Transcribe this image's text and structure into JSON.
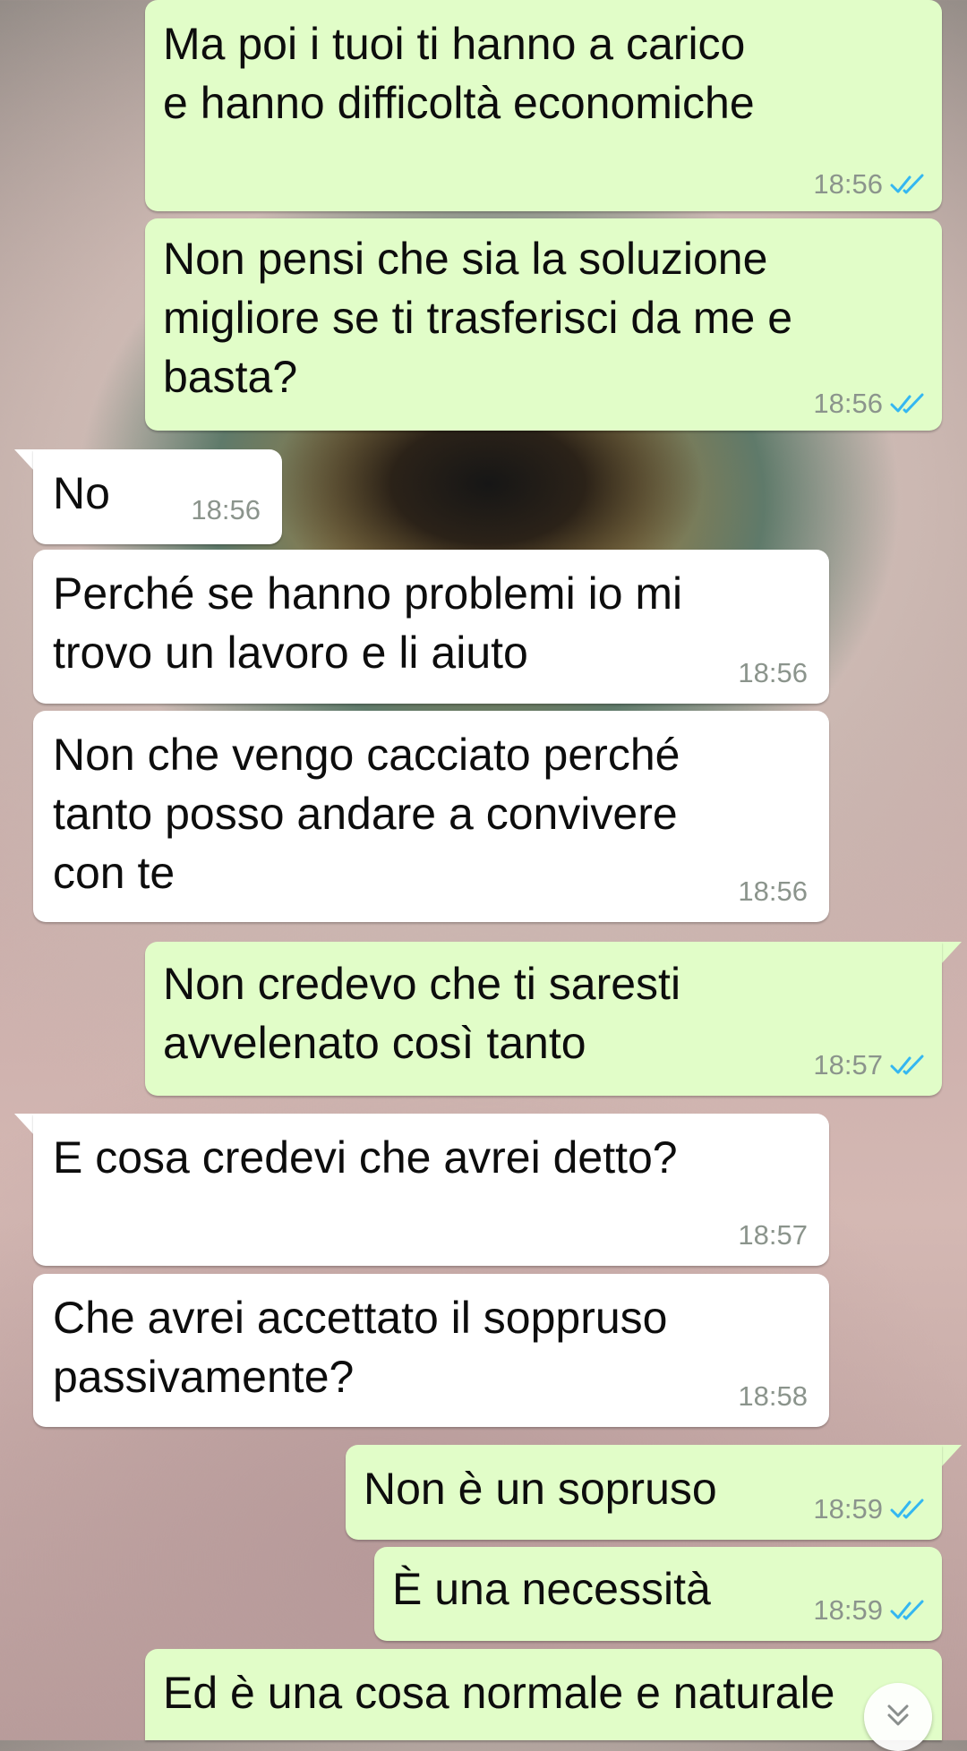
{
  "messages": [
    {
      "id": 1,
      "direction": "outgoing",
      "text": "Ma poi i tuoi ti hanno a carico\ne hanno difficoltà economiche",
      "time": "18:56",
      "status": "read"
    },
    {
      "id": 2,
      "direction": "outgoing",
      "text": "Non pensi che sia la soluzione\nmigliore se ti trasferisci da me e\nbasta?",
      "time": "18:56",
      "status": "read"
    },
    {
      "id": 3,
      "direction": "incoming",
      "text": "No",
      "time": "18:56"
    },
    {
      "id": 4,
      "direction": "incoming",
      "text": "Perché se hanno problemi io mi\ntrovo un lavoro e li aiuto",
      "time": "18:56"
    },
    {
      "id": 5,
      "direction": "incoming",
      "text": "Non che vengo cacciato perché\ntanto posso andare a convivere\ncon te",
      "time": "18:56"
    },
    {
      "id": 6,
      "direction": "outgoing",
      "text": "Non credevo che ti saresti\navvelenato così tanto",
      "time": "18:57",
      "status": "read"
    },
    {
      "id": 7,
      "direction": "incoming",
      "text": "E cosa credevi che avrei detto?",
      "time": "18:57"
    },
    {
      "id": 8,
      "direction": "incoming",
      "text": "Che avrei accettato il soppruso\npassivamente?",
      "time": "18:58"
    },
    {
      "id": 9,
      "direction": "outgoing",
      "text": "Non è un sopruso",
      "time": "18:59",
      "status": "read"
    },
    {
      "id": 10,
      "direction": "outgoing",
      "text": "È una necessità",
      "time": "18:59",
      "status": "read"
    },
    {
      "id": 11,
      "direction": "outgoing",
      "text": "Ed è una cosa normale e naturale",
      "time": "",
      "status": ""
    }
  ],
  "icons": {
    "read_receipt": "double-check-icon",
    "scroll_down": "chevron-double-down-icon"
  },
  "colors": {
    "outgoing_bubble": "#e1fdc8",
    "incoming_bubble": "#ffffff",
    "read_tick": "#34b7f1",
    "timestamp": "#8b948c"
  }
}
